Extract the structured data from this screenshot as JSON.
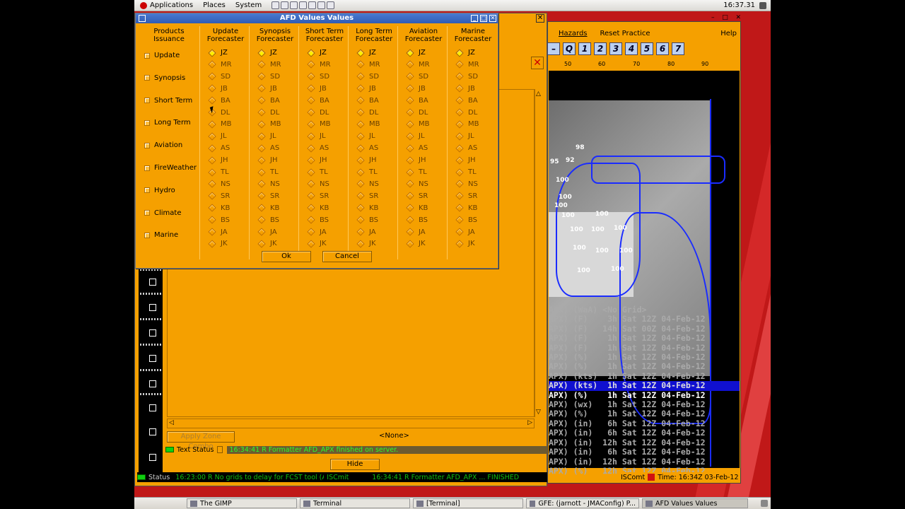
{
  "topbar": {
    "applications": "Applications",
    "places": "Places",
    "system": "System",
    "clock": "16:37.31"
  },
  "dialog": {
    "title": "AFD Values Values",
    "products_header": "Products Issuance",
    "products": [
      "Update",
      "Synopsis",
      "Short Term",
      "Long Term",
      "Aviation",
      "FireWeather",
      "Hydro",
      "Climate",
      "Marine"
    ],
    "columns": [
      {
        "header": "Update Forecaster"
      },
      {
        "header": "Synopsis Forecaster"
      },
      {
        "header": "Short Term Forecaster"
      },
      {
        "header": "Long Term Forecaster"
      },
      {
        "header": "Aviation Forecaster"
      },
      {
        "header": "Marine Forecaster"
      }
    ],
    "forecasters": [
      "JZ",
      "MR",
      "SD",
      "JB",
      "BA",
      "DL",
      "MB",
      "JL",
      "AS",
      "JH",
      "TL",
      "NS",
      "SR",
      "KB",
      "BS",
      "JA",
      "JK"
    ],
    "selected_index": 0,
    "ok_label": "Ok",
    "cancel_label": "Cancel"
  },
  "gfe": {
    "hazards": "Hazards",
    "reset": "Reset Practice",
    "help": "Help",
    "q_buttons": [
      "Q",
      "1",
      "2",
      "3",
      "4",
      "5",
      "6",
      "7"
    ],
    "scale_ticks": [
      "50",
      "60",
      "70",
      "80",
      "90"
    ],
    "apply_zone": "Apply Zone Combo",
    "none_label": "<None>",
    "text_status_label": "Text Status",
    "text_status_msg": "16:34:41 R Formatter AFD_APX finished on server.",
    "hide_label": "Hide",
    "status_label": "Status",
    "status_msg1": "16:23:00 R No grids to delay for FCST tool (APX)",
    "status_msg2": "ISCmit",
    "status_msg3": "16:34:41 R Formatter AFD_APX ... FINISHED",
    "iscomt": "ISComt",
    "time": "Time: 16:34Z 03-Feb-12"
  },
  "grids": [
    {
      "t": "APX) (WaA) <No Grid>",
      "c": "dim"
    },
    {
      "t": "APX) (F)    3h Sat 12Z 04-Feb-12",
      "c": "dim"
    },
    {
      "t": "APX) (F)   14h Sat 00Z 04-Feb-12",
      "c": "dim"
    },
    {
      "t": "APX) (F)    1h Sat 12Z 04-Feb-12",
      "c": "dim"
    },
    {
      "t": "APX) (F)    1h Sat 12Z 04-Feb-12",
      "c": "dim"
    },
    {
      "t": "APX) (%)    1h Sat 12Z 04-Feb-12",
      "c": "dim"
    },
    {
      "t": "APX) (%)    1h Sat 12Z 04-Feb-12",
      "c": "dim"
    },
    {
      "t": "APX) (kts)  1h Sat 12Z 04-Feb-12",
      "c": "dim"
    },
    {
      "t": "APX) (kts)  1h Sat 12Z 04-Feb-12",
      "c": "sel"
    },
    {
      "t": "APX) (%)    1h Sat 12Z 04-Feb-12",
      "c": "hi"
    },
    {
      "t": "APX) (wx)   1h Sat 12Z 04-Feb-12",
      "c": "dim"
    },
    {
      "t": "APX) (%)    1h Sat 12Z 04-Feb-12",
      "c": "dim"
    },
    {
      "t": "APX) (in)   6h Sat 12Z 04-Feb-12",
      "c": "dim"
    },
    {
      "t": "APX) (in)   6h Sat 12Z 04-Feb-12",
      "c": "dim"
    },
    {
      "t": "APX) (in)  12h Sat 12Z 04-Feb-12",
      "c": "dim"
    },
    {
      "t": "APX) (in)   6h Sat 12Z 04-Feb-12",
      "c": "dim"
    },
    {
      "t": "APX) (in)  12h Sat 12Z 04-Feb-12",
      "c": "dim"
    },
    {
      "t": "APX) (%)   12h Sat 12Z 04-Feb-12",
      "c": "dim"
    }
  ],
  "map_labels": [
    "95",
    "92",
    "98",
    "100",
    "100",
    "100",
    "100",
    "100",
    "100",
    "100",
    "100",
    "100",
    "100",
    "100",
    "100",
    "100"
  ],
  "taskbar": [
    {
      "label": "The GIMP"
    },
    {
      "label": "Terminal"
    },
    {
      "label": "[Terminal]"
    },
    {
      "label": "GFE: (jarnott - JMAConfig)  P..."
    },
    {
      "label": "AFD Values Values"
    }
  ]
}
